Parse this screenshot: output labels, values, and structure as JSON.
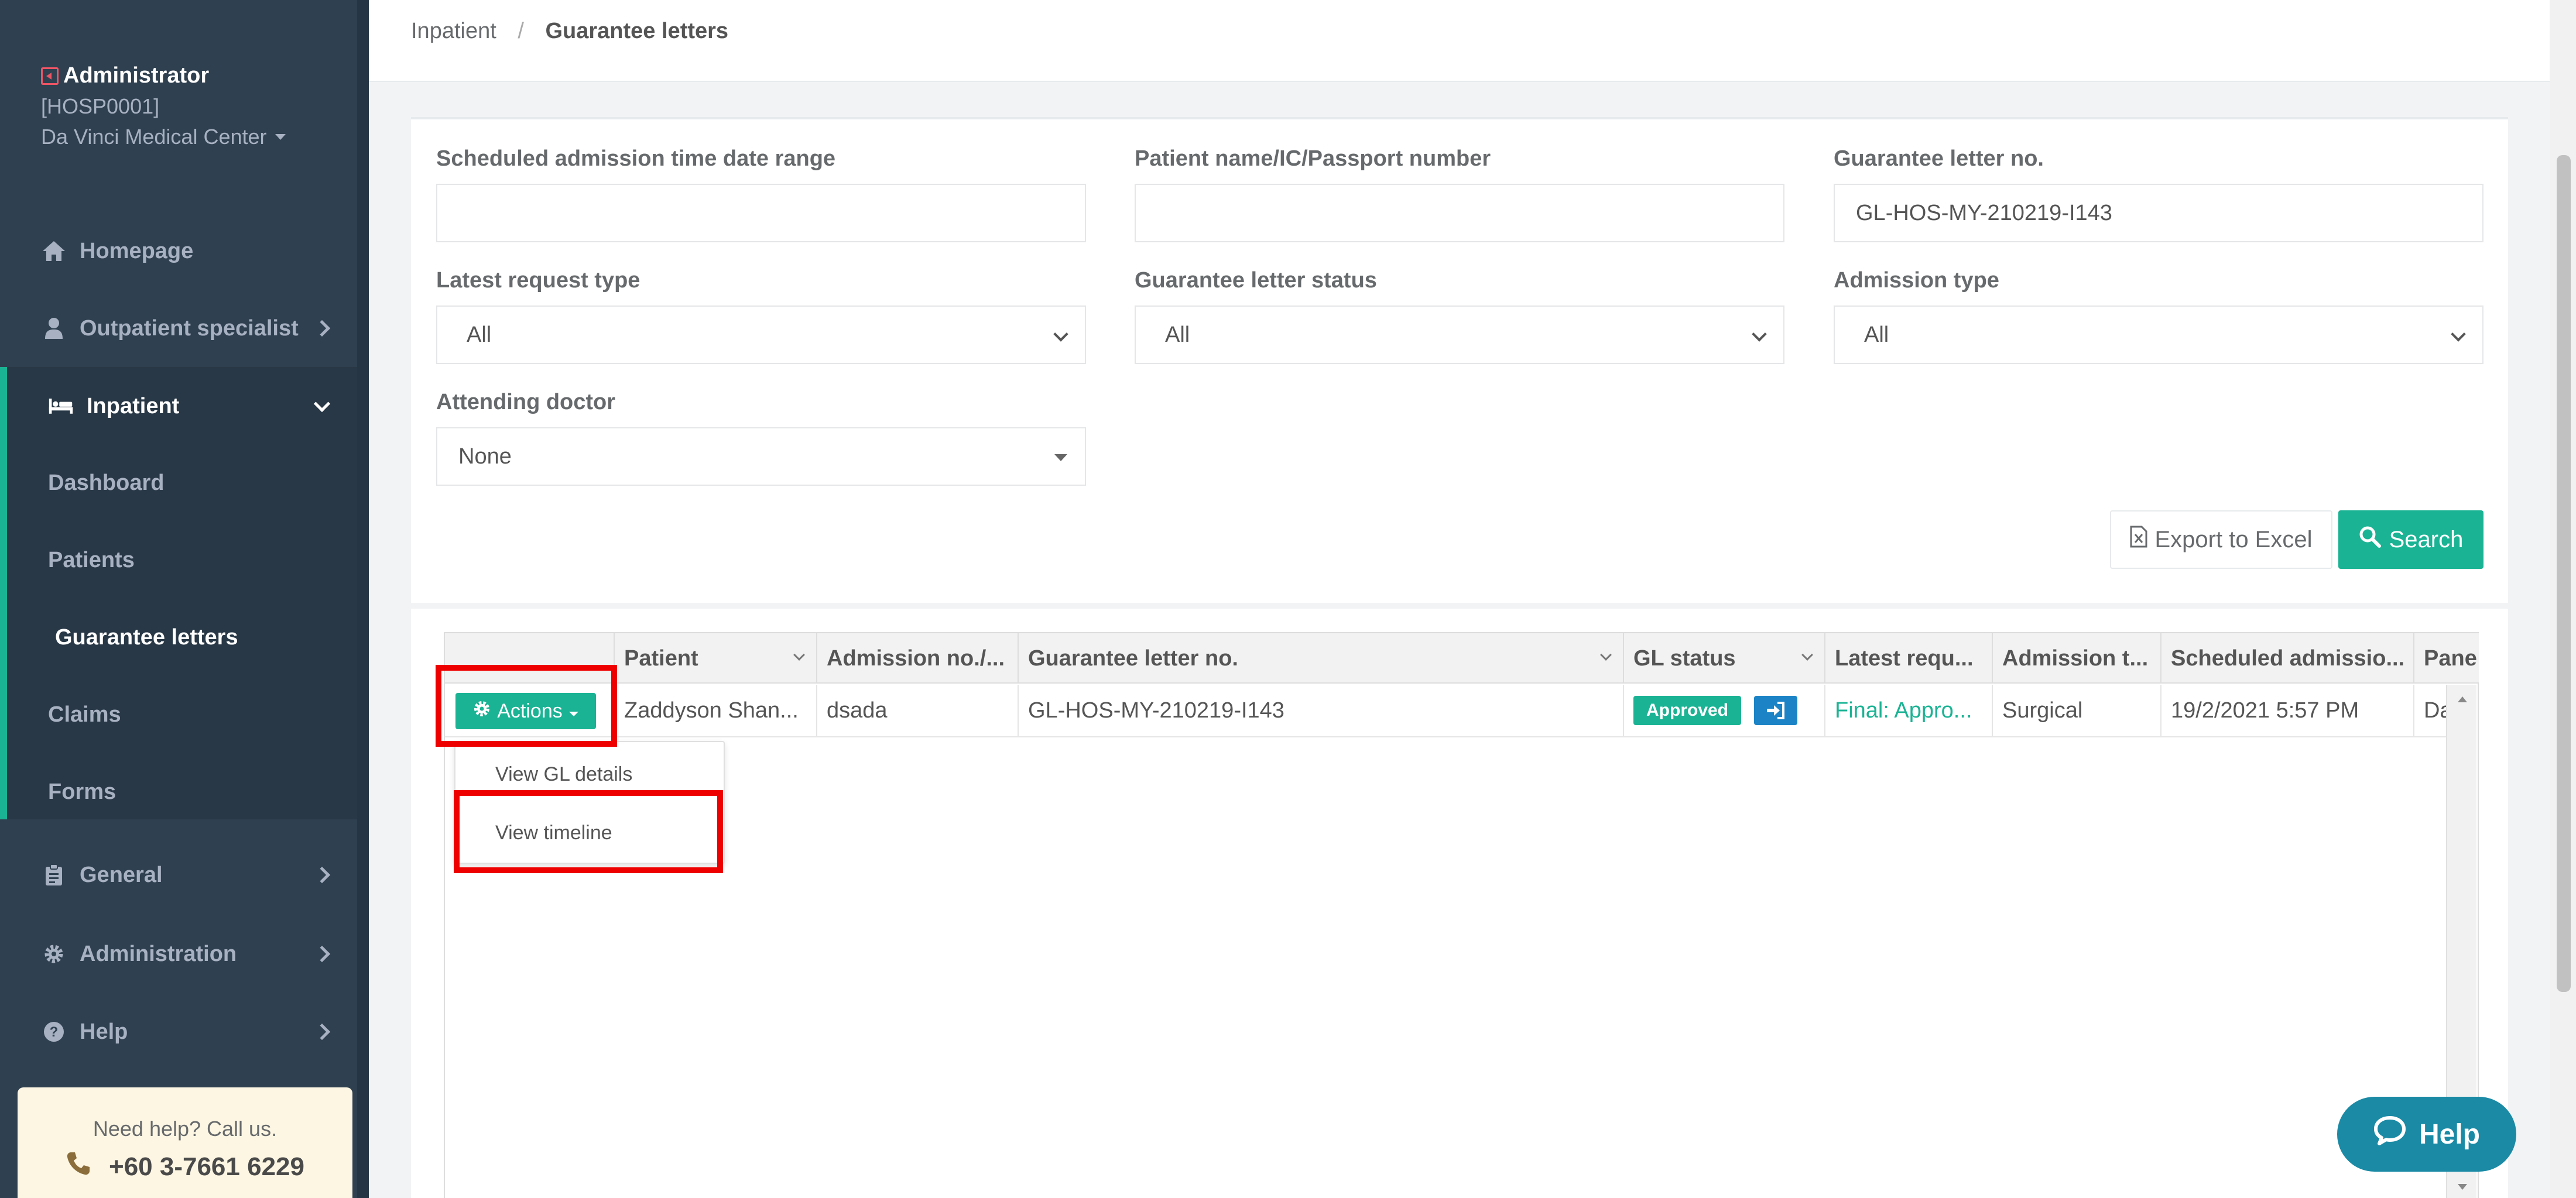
{
  "sidebar": {
    "user_name": "Administrator",
    "hospital_code": "[HOSP0001]",
    "hospital_name": "Da Vinci Medical Center",
    "items": [
      {
        "label": "Homepage",
        "icon": "home-icon"
      },
      {
        "label": "Outpatient specialist",
        "icon": "user-md-icon"
      },
      {
        "label": "Inpatient",
        "icon": "bed-icon"
      },
      {
        "label": "General",
        "icon": "clipboard-icon"
      },
      {
        "label": "Administration",
        "icon": "gear-icon"
      },
      {
        "label": "Help",
        "icon": "question-circle-icon"
      }
    ],
    "submenu": [
      "Dashboard",
      "Patients",
      "Guarantee letters",
      "Claims",
      "Forms"
    ],
    "help_text": "Need help? Call us.",
    "help_phone": "+60 3-7661 6229"
  },
  "breadcrumb": {
    "parent": "Inpatient",
    "separator": "/",
    "current": "Guarantee letters"
  },
  "filters": {
    "date_range_label": "Scheduled admission time date range",
    "date_range_value": "",
    "patient_label": "Patient name/IC/Passport number",
    "patient_value": "",
    "gl_no_label": "Guarantee letter no.",
    "gl_no_value": "GL-HOS-MY-210219-I143",
    "request_type_label": "Latest request type",
    "request_type_value": "All",
    "gl_status_label": "Guarantee letter status",
    "gl_status_value": "All",
    "admission_type_label": "Admission type",
    "admission_type_value": "All",
    "doctor_label": "Attending doctor",
    "doctor_value": "None"
  },
  "buttons": {
    "export": "Export to Excel",
    "search": "Search",
    "actions": "Actions",
    "help": "Help"
  },
  "grid": {
    "columns": [
      "Patient",
      "Admission no./...",
      "Guarantee letter no.",
      "GL status",
      "Latest requ...",
      "Admission t...",
      "Scheduled admissio...",
      "Pane"
    ],
    "rows": [
      {
        "patient": "Zaddyson Shan...",
        "admission_no": "dsada",
        "gl_no": "GL-HOS-MY-210219-I143",
        "gl_status": "Approved",
        "latest_request": "Final: Appro...",
        "admission_type": "Surgical",
        "scheduled": "19/2/2021 5:57 PM",
        "panel": "Da"
      }
    ]
  },
  "actions_menu": [
    "View GL details",
    "View timeline"
  ],
  "colors": {
    "accent": "#1ab394",
    "sidebar": "#2f4050",
    "info": "#1c84c6",
    "highlight": "#ee0000"
  }
}
